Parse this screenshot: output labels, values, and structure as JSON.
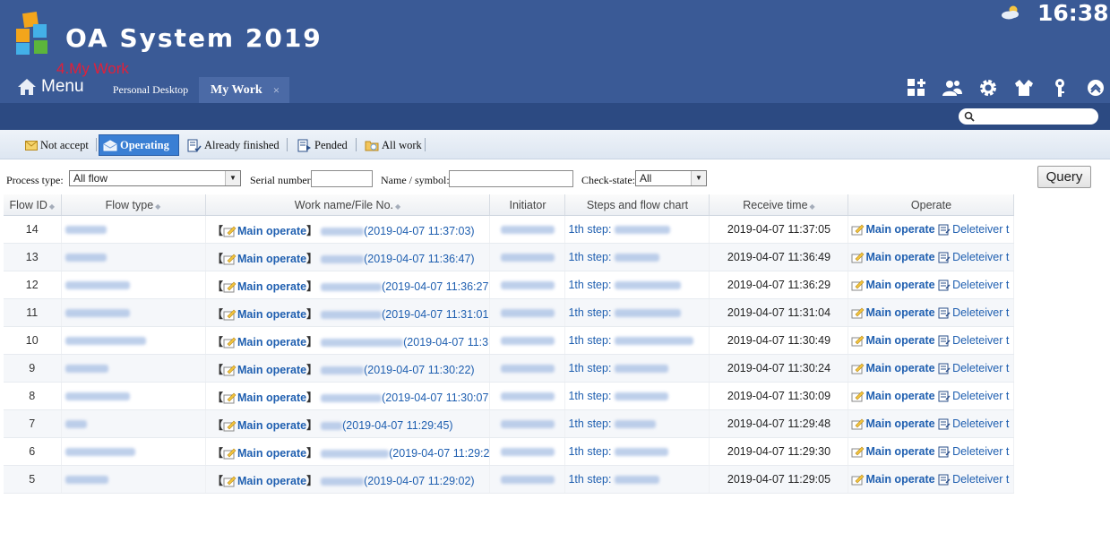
{
  "header": {
    "app_title": "OA System 2019",
    "annotation": "4.My Work",
    "clock": "16:38",
    "menu_label": "Menu",
    "tabs": [
      {
        "label": "Personal Desktop",
        "close": ""
      },
      {
        "label": "My Work",
        "close": "×"
      }
    ],
    "tool_icons": [
      "apps-add-icon",
      "user-group-icon",
      "gear-icon",
      "shirt-icon",
      "key-icon",
      "collapse-up-icon"
    ],
    "weather_icon": "cloud-sun-icon",
    "search": {
      "value": "",
      "placeholder": ""
    }
  },
  "status_tabs": [
    {
      "label": "Not accept",
      "icon": "envelope-icon"
    },
    {
      "label": "Operating",
      "icon": "open-envelope-icon",
      "active": true
    },
    {
      "label": "Already finished",
      "icon": "doc-check-icon"
    },
    {
      "label": "Pended",
      "icon": "doc-pause-icon"
    },
    {
      "label": "All work",
      "icon": "folder-icon"
    }
  ],
  "filters": {
    "process_type_label": "Process type:",
    "process_type_value": "All flow",
    "serial_label": "Serial number:",
    "serial_value": "",
    "name_label": "Name / symbol:",
    "name_value": "",
    "check_label": "Check-state:",
    "check_value": "All",
    "query_label": "Query"
  },
  "table": {
    "columns": [
      "Flow ID",
      "Flow type",
      "Work name/File No.",
      "Initiator",
      "Steps and flow chart",
      "Receive time",
      "Operate"
    ],
    "operate_main": "Main operate",
    "operate_delete": "Deleteiver t",
    "bracket_open": "【",
    "bracket_close": "】",
    "step_prefix": "1th step:",
    "rows": [
      {
        "id": "14",
        "work_time": "(2019-04-07 11:37:03)",
        "receive": "2019-04-07 11:37:05"
      },
      {
        "id": "13",
        "work_time": "(2019-04-07 11:36:47)",
        "receive": "2019-04-07 11:36:49"
      },
      {
        "id": "12",
        "work_time": "(2019-04-07 11:36:27",
        "receive": "2019-04-07 11:36:29"
      },
      {
        "id": "11",
        "work_time": "(2019-04-07 11:31:01",
        "receive": "2019-04-07 11:31:04"
      },
      {
        "id": "10",
        "work_time": "(2019-04-07 11:3",
        "receive": "2019-04-07 11:30:49"
      },
      {
        "id": "9",
        "work_time": "(2019-04-07 11:30:22)",
        "receive": "2019-04-07 11:30:24"
      },
      {
        "id": "8",
        "work_time": "(2019-04-07 11:30:07",
        "receive": "2019-04-07 11:30:09"
      },
      {
        "id": "7",
        "work_time": "(2019-04-07 11:29:45)",
        "receive": "2019-04-07 11:29:48"
      },
      {
        "id": "6",
        "work_time": "(2019-04-07 11:29:2",
        "receive": "2019-04-07 11:29:30"
      },
      {
        "id": "5",
        "work_time": "(2019-04-07 11:29:02)",
        "receive": "2019-04-07 11:29:05"
      }
    ]
  },
  "colors": {
    "header_bg": "#3a5a96",
    "subbar_bg": "#2c4a82",
    "link": "#1f5fb0",
    "annotation": "#e0203a",
    "active_tab": "#3a7fd4"
  }
}
